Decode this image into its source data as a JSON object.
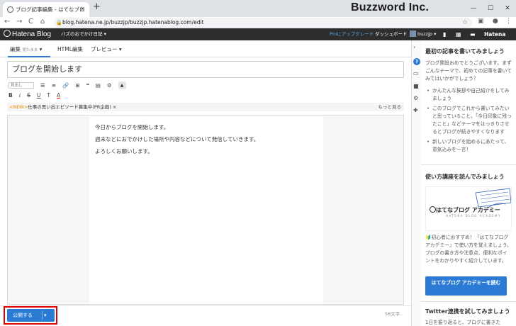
{
  "browser": {
    "tab_title": "ブログ記事編集 - はてなブログ",
    "tab_close": "×",
    "new_tab": "+",
    "url": "blog.hatena.ne.jp/buzzjp/buzzjp.hatenablog.com/edit",
    "watermark": "Buzzword Inc.",
    "nav": {
      "back": "←",
      "forward": "→",
      "reload": "C",
      "home": "⌂"
    },
    "window_controls": {
      "minimize": "—",
      "maximize": "☐",
      "close": "✕"
    }
  },
  "header": {
    "logo": "Hatena Blog",
    "blog_name": "バズのおでかけ日記 ▾",
    "pro_upgrade": "Proにアップグレード",
    "dashboard": "ダッシュボード",
    "user": "buzzjp ▾",
    "hatena": "Hatena"
  },
  "editor_tabs": {
    "edit": "編集",
    "edit_sub": "見たまま",
    "html": "HTML編集",
    "preview": "プレビュー"
  },
  "title_value": "ブログを開始します",
  "toolbar": {
    "format_select": "見出し",
    "row1": [
      "☰",
      "≡",
      "🔗",
      "⊞",
      "❝",
      "▤",
      "⚙"
    ],
    "row2": [
      "B",
      "i",
      "S",
      "U",
      "T",
      "A"
    ]
  },
  "news": {
    "tag": "<NEW>",
    "text": "仕事の思い出エピソード募集中(PR企画)",
    "close": "×",
    "more": "もっと見る"
  },
  "body_lines": [
    "今日からブログを開始します。",
    "週末などにおでかけした場所や内容などについて発信していきます。",
    "よろしくお願いします。"
  ],
  "footer": {
    "publish": "公開する",
    "caret": "▾",
    "char_count": "56文字"
  },
  "sidebar": {
    "section1_title": "最初の記事を書いてみましょう",
    "section1_text": "ブログ開設おめでとうございます。まずごんなテーマで、初めての記事を書いてみてはいかがでしょう？",
    "section1_items": [
      "かんたんな挨拶や自己紹介をしてみましょう",
      "このブログでこれから書いてみたいと思っていること。「今日印象に残ったこと」などテーマをはっきりさせるとブログが続きやすくなります",
      "新しいブログを始めるにあたって、意気込みを一言！"
    ],
    "section2_title": "使い方講座を読んでみましょう",
    "academy_logo": "はてなブログ アカデミー",
    "academy_sub": "HATENA BLOG ACADEMY",
    "section2_text": "🔰初心者におすすめ！「はてなブログ アカデミー」で使い方を覚えましょう。ブログの書き方や注意点、便利なポイントをわかりやすく紹介しています。",
    "academy_button": "はてなブログ アカデミーを読む",
    "section3_title": "Twitter連携を試してみましょう",
    "section3_text": "1日を振り返ると、ブログに書きた"
  },
  "colors": {
    "accent": "#2b7bd4",
    "header_bg": "#2d2d2d",
    "highlight": "#e00000",
    "new_tag": "#f08c00"
  }
}
